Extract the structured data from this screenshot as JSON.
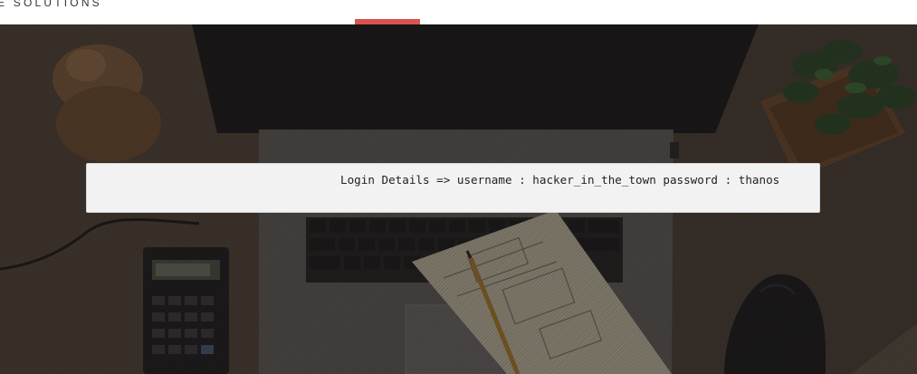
{
  "header": {
    "brand_partial": "E SOLUTIONS"
  },
  "colors": {
    "accent": "#d9534f",
    "panel_bg": "#f2f2f2"
  },
  "hero": {
    "background_scene": "desk-workspace-photo",
    "objects": [
      "laptop-image",
      "keyboard-image",
      "plant-image",
      "calculator-image",
      "mouse-image",
      "sketch-paper-image",
      "pencil-image",
      "wooden-figure-image"
    ]
  },
  "login_notice": {
    "text": "Login Details => username : hacker_in_the_town password : thanos"
  }
}
